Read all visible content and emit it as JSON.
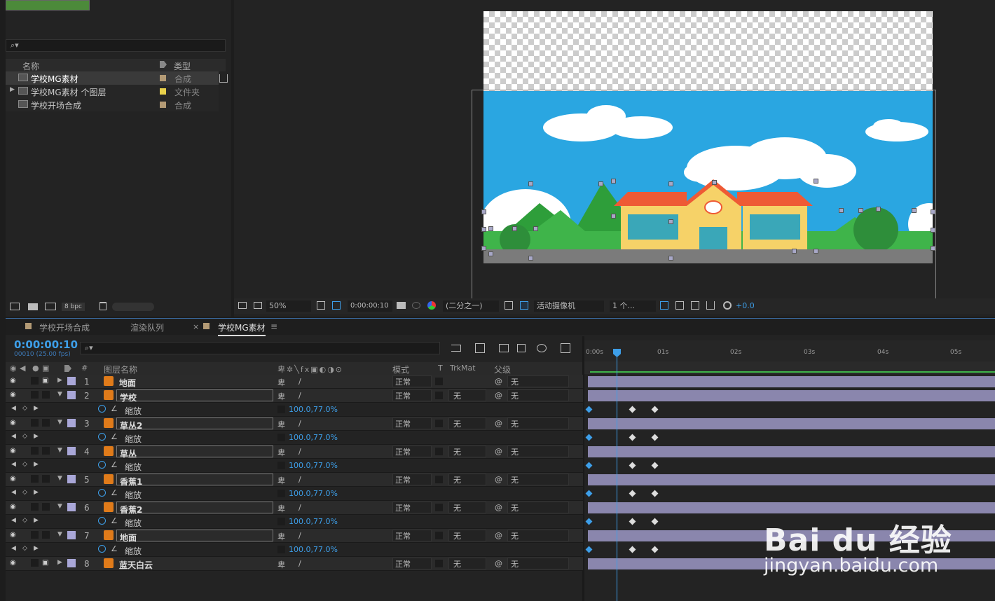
{
  "project": {
    "search_placeholder": "⌕▾",
    "col_name": "名称",
    "col_type": "类型",
    "items": [
      {
        "name": "学校MG素材",
        "type": "合成",
        "color": "#b39a75",
        "selected": true
      },
      {
        "name": "学校MG素材 个图层",
        "type": "文件夹",
        "color": "#e8d04a",
        "selected": false
      },
      {
        "name": "学校开场合成",
        "type": "合成",
        "color": "#b39a75",
        "selected": false
      }
    ],
    "footer_bpc": "8 bpc"
  },
  "viewer": {
    "zoom": "50%",
    "timecode": "0:00:00:10",
    "resolution": "(二分之一)",
    "camera": "活动摄像机",
    "views": "1 个...",
    "exposure": "+0.0"
  },
  "timeline": {
    "tabs": [
      {
        "label": "学校开场合成"
      },
      {
        "label": "渲染队列"
      },
      {
        "label": "学校MG素材"
      }
    ],
    "timecode": "0:00:00:10",
    "timecode_sub": "00010 (25.00 fps)",
    "columns": {
      "num": "#",
      "layer_name": "图层名称",
      "mode": "模式",
      "t": "T",
      "trkmat": "TrkMat",
      "parent": "父级"
    },
    "ruler": [
      "0:00s",
      "01s",
      "02s",
      "03s",
      "04s",
      "05s"
    ],
    "layers": [
      {
        "num": "1",
        "name": "地面",
        "mode": "正常",
        "trkmat": "",
        "parent": "无",
        "expanded": false,
        "locked": true
      },
      {
        "num": "2",
        "name": "学校",
        "mode": "正常",
        "trkmat": "无",
        "parent": "无",
        "expanded": true,
        "prop": "缩放",
        "value": "100.0,77.0%"
      },
      {
        "num": "3",
        "name": "草丛2",
        "mode": "正常",
        "trkmat": "无",
        "parent": "无",
        "expanded": true,
        "prop": "缩放",
        "value": "100.0,77.0%"
      },
      {
        "num": "4",
        "name": "草丛",
        "mode": "正常",
        "trkmat": "无",
        "parent": "无",
        "expanded": true,
        "prop": "缩放",
        "value": "100.0,77.0%"
      },
      {
        "num": "5",
        "name": "香蕉1",
        "mode": "正常",
        "trkmat": "无",
        "parent": "无",
        "expanded": true,
        "prop": "缩放",
        "value": "100.0,77.0%"
      },
      {
        "num": "6",
        "name": "香蕉2",
        "mode": "正常",
        "trkmat": "无",
        "parent": "无",
        "expanded": true,
        "prop": "缩放",
        "value": "100.0,77.0%"
      },
      {
        "num": "7",
        "name": "地面",
        "mode": "正常",
        "trkmat": "无",
        "parent": "无",
        "expanded": true,
        "prop": "缩放",
        "value": "100.0,77.0%"
      },
      {
        "num": "8",
        "name": "蓝天白云",
        "mode": "正常",
        "trkmat": "无",
        "parent": "无",
        "expanded": false,
        "locked": true
      }
    ]
  },
  "watermark": {
    "brand": "Bai du 经验",
    "url": "jingyan.baidu.com"
  },
  "colors": {
    "accent": "#3d9ee8",
    "label": "#a9a7d8",
    "sky": "#2aa6e1"
  }
}
